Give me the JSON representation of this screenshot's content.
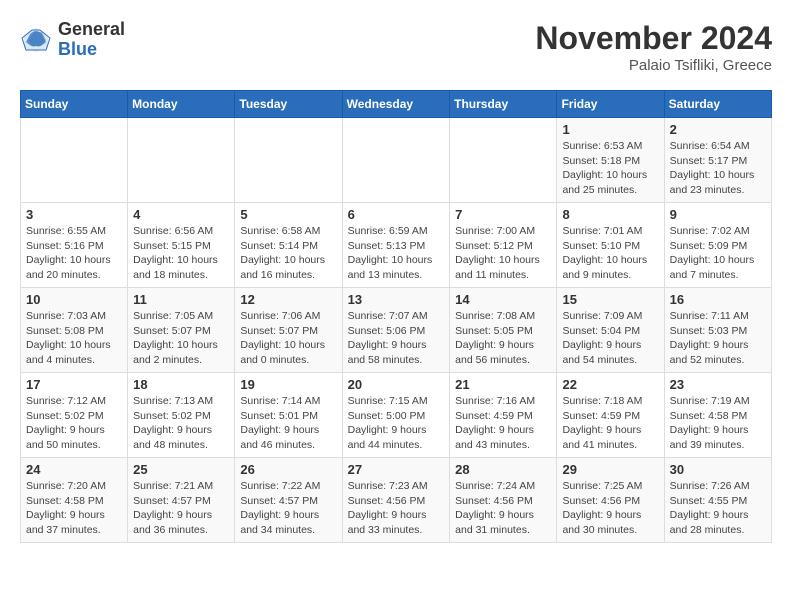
{
  "header": {
    "logo_general": "General",
    "logo_blue": "Blue",
    "title": "November 2024",
    "location": "Palaio Tsifliki, Greece"
  },
  "days_of_week": [
    "Sunday",
    "Monday",
    "Tuesday",
    "Wednesday",
    "Thursday",
    "Friday",
    "Saturday"
  ],
  "weeks": [
    [
      {
        "day": "",
        "info": ""
      },
      {
        "day": "",
        "info": ""
      },
      {
        "day": "",
        "info": ""
      },
      {
        "day": "",
        "info": ""
      },
      {
        "day": "",
        "info": ""
      },
      {
        "day": "1",
        "info": "Sunrise: 6:53 AM\nSunset: 5:18 PM\nDaylight: 10 hours and 25 minutes."
      },
      {
        "day": "2",
        "info": "Sunrise: 6:54 AM\nSunset: 5:17 PM\nDaylight: 10 hours and 23 minutes."
      }
    ],
    [
      {
        "day": "3",
        "info": "Sunrise: 6:55 AM\nSunset: 5:16 PM\nDaylight: 10 hours and 20 minutes."
      },
      {
        "day": "4",
        "info": "Sunrise: 6:56 AM\nSunset: 5:15 PM\nDaylight: 10 hours and 18 minutes."
      },
      {
        "day": "5",
        "info": "Sunrise: 6:58 AM\nSunset: 5:14 PM\nDaylight: 10 hours and 16 minutes."
      },
      {
        "day": "6",
        "info": "Sunrise: 6:59 AM\nSunset: 5:13 PM\nDaylight: 10 hours and 13 minutes."
      },
      {
        "day": "7",
        "info": "Sunrise: 7:00 AM\nSunset: 5:12 PM\nDaylight: 10 hours and 11 minutes."
      },
      {
        "day": "8",
        "info": "Sunrise: 7:01 AM\nSunset: 5:10 PM\nDaylight: 10 hours and 9 minutes."
      },
      {
        "day": "9",
        "info": "Sunrise: 7:02 AM\nSunset: 5:09 PM\nDaylight: 10 hours and 7 minutes."
      }
    ],
    [
      {
        "day": "10",
        "info": "Sunrise: 7:03 AM\nSunset: 5:08 PM\nDaylight: 10 hours and 4 minutes."
      },
      {
        "day": "11",
        "info": "Sunrise: 7:05 AM\nSunset: 5:07 PM\nDaylight: 10 hours and 2 minutes."
      },
      {
        "day": "12",
        "info": "Sunrise: 7:06 AM\nSunset: 5:07 PM\nDaylight: 10 hours and 0 minutes."
      },
      {
        "day": "13",
        "info": "Sunrise: 7:07 AM\nSunset: 5:06 PM\nDaylight: 9 hours and 58 minutes."
      },
      {
        "day": "14",
        "info": "Sunrise: 7:08 AM\nSunset: 5:05 PM\nDaylight: 9 hours and 56 minutes."
      },
      {
        "day": "15",
        "info": "Sunrise: 7:09 AM\nSunset: 5:04 PM\nDaylight: 9 hours and 54 minutes."
      },
      {
        "day": "16",
        "info": "Sunrise: 7:11 AM\nSunset: 5:03 PM\nDaylight: 9 hours and 52 minutes."
      }
    ],
    [
      {
        "day": "17",
        "info": "Sunrise: 7:12 AM\nSunset: 5:02 PM\nDaylight: 9 hours and 50 minutes."
      },
      {
        "day": "18",
        "info": "Sunrise: 7:13 AM\nSunset: 5:02 PM\nDaylight: 9 hours and 48 minutes."
      },
      {
        "day": "19",
        "info": "Sunrise: 7:14 AM\nSunset: 5:01 PM\nDaylight: 9 hours and 46 minutes."
      },
      {
        "day": "20",
        "info": "Sunrise: 7:15 AM\nSunset: 5:00 PM\nDaylight: 9 hours and 44 minutes."
      },
      {
        "day": "21",
        "info": "Sunrise: 7:16 AM\nSunset: 4:59 PM\nDaylight: 9 hours and 43 minutes."
      },
      {
        "day": "22",
        "info": "Sunrise: 7:18 AM\nSunset: 4:59 PM\nDaylight: 9 hours and 41 minutes."
      },
      {
        "day": "23",
        "info": "Sunrise: 7:19 AM\nSunset: 4:58 PM\nDaylight: 9 hours and 39 minutes."
      }
    ],
    [
      {
        "day": "24",
        "info": "Sunrise: 7:20 AM\nSunset: 4:58 PM\nDaylight: 9 hours and 37 minutes."
      },
      {
        "day": "25",
        "info": "Sunrise: 7:21 AM\nSunset: 4:57 PM\nDaylight: 9 hours and 36 minutes."
      },
      {
        "day": "26",
        "info": "Sunrise: 7:22 AM\nSunset: 4:57 PM\nDaylight: 9 hours and 34 minutes."
      },
      {
        "day": "27",
        "info": "Sunrise: 7:23 AM\nSunset: 4:56 PM\nDaylight: 9 hours and 33 minutes."
      },
      {
        "day": "28",
        "info": "Sunrise: 7:24 AM\nSunset: 4:56 PM\nDaylight: 9 hours and 31 minutes."
      },
      {
        "day": "29",
        "info": "Sunrise: 7:25 AM\nSunset: 4:56 PM\nDaylight: 9 hours and 30 minutes."
      },
      {
        "day": "30",
        "info": "Sunrise: 7:26 AM\nSunset: 4:55 PM\nDaylight: 9 hours and 28 minutes."
      }
    ]
  ]
}
